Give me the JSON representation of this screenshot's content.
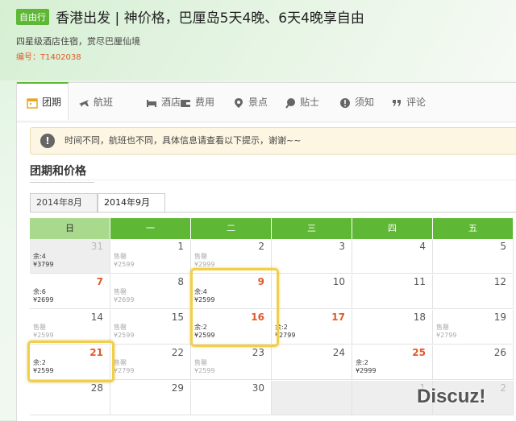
{
  "header": {
    "tag": "自由行",
    "title": "香港出发 | 神价格，巴厘岛5天4晚、6天4晚享自由",
    "subtitle": "四星级酒店住宿，赏尽巴厘仙境",
    "code": "编号：T1402038"
  },
  "tabs": [
    {
      "label": "团期",
      "icon": "calendar-icon"
    },
    {
      "label": "航班",
      "icon": "plane-icon"
    },
    {
      "label": "酒店",
      "icon": "bed-icon"
    },
    {
      "label": "费用",
      "icon": "wallet-icon"
    },
    {
      "label": "景点",
      "icon": "pin-icon"
    },
    {
      "label": "贴士",
      "icon": "tip-icon"
    },
    {
      "label": "须知",
      "icon": "warning-icon"
    },
    {
      "label": "评论",
      "icon": "comment-icon"
    }
  ],
  "notice": {
    "icon": "alert-icon",
    "text": "时间不同，航班也不同，具体信息请查看以下提示，谢谢~~"
  },
  "section_title": "团期和价格",
  "month_tabs": [
    "2014年8月",
    "2014年9月"
  ],
  "weekdays": [
    "日",
    "一",
    "二",
    "三",
    "四",
    "五"
  ],
  "calendar": [
    [
      {
        "d": "31",
        "l1": "余:4",
        "l2": "¥3799",
        "style": "light",
        "gray": true
      },
      {
        "d": "1",
        "l1": "售罄",
        "l2": "¥2599",
        "sold": true
      },
      {
        "d": "2",
        "l1": "售罄",
        "l2": "¥2999",
        "sold": true
      },
      {
        "d": "3"
      },
      {
        "d": "4"
      },
      {
        "d": "5"
      }
    ],
    [
      {
        "d": "7",
        "l1": "余:6",
        "l2": "¥2699",
        "style": "red"
      },
      {
        "d": "8",
        "l1": "售罄",
        "l2": "¥2699",
        "sold": true
      },
      {
        "d": "9",
        "l1": "余:4",
        "l2": "¥2599",
        "style": "red"
      },
      {
        "d": "10"
      },
      {
        "d": "11"
      },
      {
        "d": "12"
      }
    ],
    [
      {
        "d": "14",
        "l1": "售罄",
        "l2": "¥2599",
        "sold": true
      },
      {
        "d": "15",
        "l1": "售罄",
        "l2": "¥2599",
        "sold": true
      },
      {
        "d": "16",
        "l1": "余:2",
        "l2": "¥2599",
        "style": "red"
      },
      {
        "d": "17",
        "l1": "余:2",
        "l2": "¥2799",
        "style": "red"
      },
      {
        "d": "18"
      },
      {
        "d": "19",
        "l1": "售罄",
        "l2": "¥2799",
        "sold": true
      }
    ],
    [
      {
        "d": "21",
        "l1": "余:2",
        "l2": "¥2599",
        "style": "red"
      },
      {
        "d": "22",
        "l1": "售罄",
        "l2": "¥2799",
        "sold": true
      },
      {
        "d": "23",
        "l1": "售罄",
        "l2": "¥2599",
        "sold": true
      },
      {
        "d": "24"
      },
      {
        "d": "25",
        "l1": "余:2",
        "l2": "¥2999",
        "style": "red"
      },
      {
        "d": "26"
      }
    ],
    [
      {
        "d": "28"
      },
      {
        "d": "29"
      },
      {
        "d": "30"
      },
      {
        "d": "",
        "gray": true
      },
      {
        "d": "1",
        "style": "light",
        "gray": true
      },
      {
        "d": "2",
        "style": "light",
        "gray": true
      }
    ]
  ],
  "watermark": "Discuz!",
  "colors": {
    "accent": "#5fb736",
    "highlight": "#f2cf4a",
    "price_red": "#e05a2a"
  }
}
